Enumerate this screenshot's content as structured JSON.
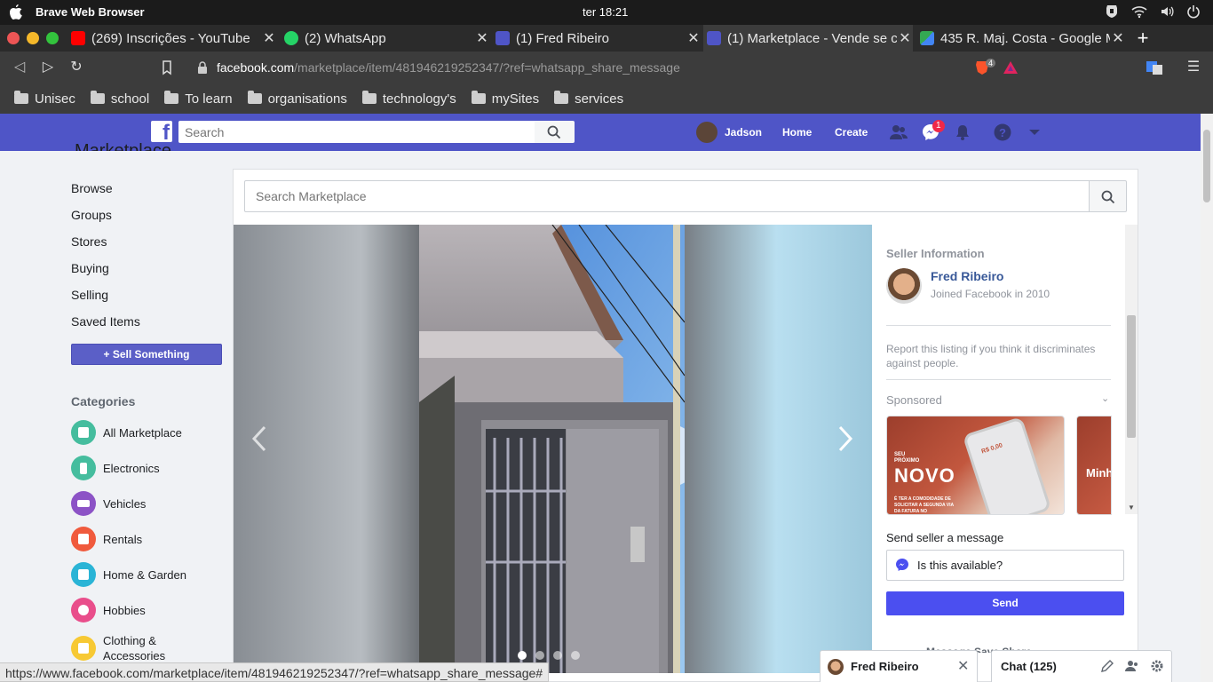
{
  "os": {
    "app_title": "Brave Web Browser",
    "clock": "ter 18:21"
  },
  "tabs": [
    {
      "title": "(269) Inscrições - YouTube",
      "icon": "youtube-icon",
      "color": "#ff0000"
    },
    {
      "title": "(2) WhatsApp",
      "icon": "whatsapp-icon",
      "color": "#25d366"
    },
    {
      "title": "(1) Fred Ribeiro",
      "icon": "facebook-icon",
      "color": "#4f55c7"
    },
    {
      "title": "(1) Marketplace - Vende se c",
      "icon": "facebook-icon",
      "color": "#4f55c7",
      "active": true
    },
    {
      "title": "435 R. Maj. Costa - Google M",
      "icon": "google-maps-icon",
      "color": "#34a853"
    }
  ],
  "address": {
    "domain": "facebook.com",
    "path": "/marketplace/item/481946219252347/?ref=whatsapp_share_message",
    "brave_count": "4"
  },
  "bookmarks": [
    "Unisec",
    "school",
    "To learn",
    "organisations",
    "technology's",
    "mySites",
    "services"
  ],
  "fb": {
    "search_placeholder": "Search",
    "user_name": "Jadson",
    "home_label": "Home",
    "create_label": "Create",
    "messenger_badge": "1",
    "brand_color": "#4f55c7"
  },
  "marketplace": {
    "heading": "Marketplace",
    "search_placeholder": "Search Marketplace",
    "nav": [
      "Browse",
      "Groups",
      "Stores",
      "Buying",
      "Selling",
      "Saved Items"
    ],
    "sell_button": "Sell Something",
    "categories_title": "Categories",
    "categories": [
      {
        "label": "All Marketplace",
        "icon": "marketplace-icon",
        "color": "#45bd9e"
      },
      {
        "label": "Electronics",
        "icon": "phone-icon",
        "color": "#45bd9e"
      },
      {
        "label": "Vehicles",
        "icon": "car-icon",
        "color": "#8c53c6"
      },
      {
        "label": "Rentals",
        "icon": "house-dollar-icon",
        "color": "#f05a3d"
      },
      {
        "label": "Home & Garden",
        "icon": "home-icon",
        "color": "#2ab4d6"
      },
      {
        "label": "Hobbies",
        "icon": "guitar-icon",
        "color": "#e94e8b"
      },
      {
        "label": "Clothing & Accessories",
        "icon": "shirt-icon",
        "color": "#f7c934"
      }
    ]
  },
  "viewer": {
    "photo_count": 4,
    "active_photo": 1
  },
  "seller": {
    "section_title": "Seller Information",
    "name": "Fred Ribeiro",
    "joined": "Joined Facebook in 2010",
    "report_text": "Report this listing if you think it discriminates against people.",
    "sponsored_label": "Sponsored",
    "ad1_small": "SEU PRÓXIMO",
    "ad1_big": "NOVO",
    "ad1_caption": "É TER A COMODIDADE DE SOLICITAR A SEGUNDA VIA DA FATURA NO",
    "ad1_phone": "R$ 0,00",
    "ad2_text": "Minh"
  },
  "message": {
    "label": "Send seller a message",
    "value": "Is this available?",
    "send_label": "Send",
    "cut_row": "Message   Save   Share"
  },
  "chat": {
    "open_name": "Fred Ribeiro",
    "list_label": "Chat (125)"
  },
  "status_url": "https://www.facebook.com/marketplace/item/481946219252347/?ref=whatsapp_share_message#"
}
